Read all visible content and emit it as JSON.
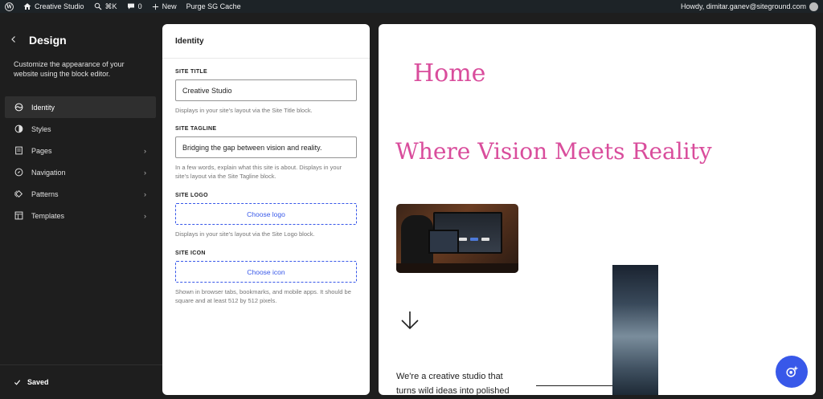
{
  "adminbar": {
    "site_name": "Creative Studio",
    "shortcut": "⌘K",
    "comments_count": "0",
    "new_label": "New",
    "purge_label": "Purge SG Cache",
    "howdy": "Howdy, dimitar.ganev@siteground.com"
  },
  "sidebar": {
    "title": "Design",
    "description": "Customize the appearance of your website using the block editor.",
    "items": [
      {
        "label": "Identity",
        "icon": "identity-icon",
        "active": true
      },
      {
        "label": "Styles",
        "icon": "styles-icon"
      },
      {
        "label": "Pages",
        "icon": "pages-icon",
        "chevron": true
      },
      {
        "label": "Navigation",
        "icon": "navigation-icon",
        "chevron": true
      },
      {
        "label": "Patterns",
        "icon": "patterns-icon",
        "chevron": true
      },
      {
        "label": "Templates",
        "icon": "templates-icon",
        "chevron": true
      }
    ],
    "saved_label": "Saved"
  },
  "panel": {
    "title": "Identity",
    "site_title": {
      "label": "SITE TITLE",
      "value": "Creative Studio",
      "help": "Displays in your site's layout via the Site Title block."
    },
    "site_tagline": {
      "label": "SITE TAGLINE",
      "value": "Bridging the gap between vision and reality.",
      "help": "In a few words, explain what this site is about. Displays in your site's layout via the Site Tagline block."
    },
    "site_logo": {
      "label": "SITE LOGO",
      "button": "Choose logo",
      "help": "Displays in your site's layout via the Site Logo block."
    },
    "site_icon": {
      "label": "SITE ICON",
      "button": "Choose icon",
      "help": "Shown in browser tabs, bookmarks, and mobile apps. It should be square and at least 512 by 512 pixels."
    }
  },
  "preview": {
    "page_title": "Home",
    "headline": "Where Vision Meets Reality",
    "intro_text": "We're a creative studio that turns wild ideas into polished"
  },
  "colors": {
    "accent": "#3858e9",
    "heading_pink": "#d94d9c",
    "dark_bg": "#1e1e1e"
  }
}
